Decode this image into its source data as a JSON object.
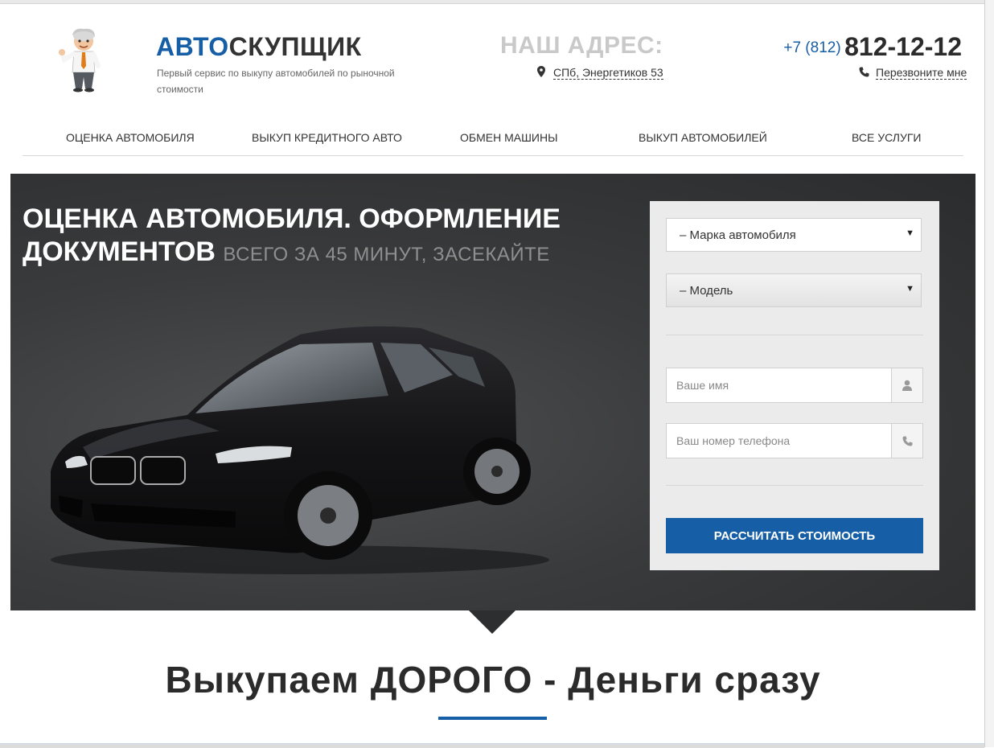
{
  "header": {
    "logo_part1": "АВТО",
    "logo_part2": "СКУПЩИК",
    "tagline": "Первый сервис по выкупу автомобилей по рыночной стоимости",
    "address_title": "НАШ АДРЕС:",
    "address": "СПб, Энергетиков 53",
    "phone_code": "+7 (812)",
    "phone_number": "812-12-12",
    "callback_label": "Перезвоните мне"
  },
  "nav": {
    "items": [
      {
        "label": "Оценка автомобиля"
      },
      {
        "label": "Выкуп кредитного авто"
      },
      {
        "label": "Обмен машины"
      },
      {
        "label": "Выкуп автомобилей"
      },
      {
        "label": "Все услуги"
      }
    ]
  },
  "hero": {
    "title": "Оценка автомобиля. Оформление документов",
    "subtitle": "всего за 45 минут, засекайте"
  },
  "form": {
    "brand_select": "– Марка автомобиля",
    "model_select": "– Модель",
    "name_placeholder": "Ваше имя",
    "phone_placeholder": "Ваш номер телефона",
    "submit_label": "Рассчитать стоимость"
  },
  "section": {
    "slogan": "Выкупаем ДОРОГО - Деньги сразу"
  },
  "colors": {
    "accent": "#165ea6",
    "hero_bg": "#3a3b3c",
    "form_bg": "#ebebeb"
  },
  "icons": [
    "mascot-icon",
    "map-pin-icon",
    "phone-icon",
    "user-icon",
    "phone-icon",
    "caret-down-icon"
  ]
}
